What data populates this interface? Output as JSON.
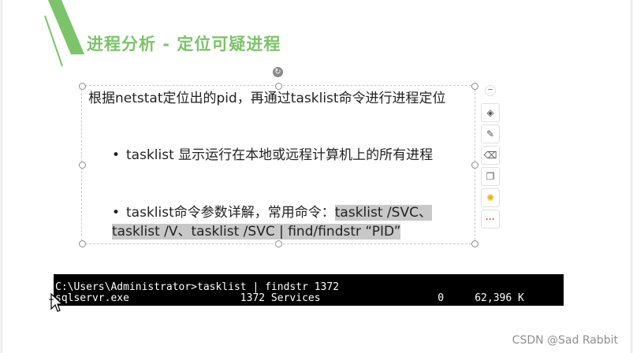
{
  "slide": {
    "title": "进程分析 - 定位可疑进程",
    "paragraph1": "根据netstat定位出的pid，再通过tasklist命令进行进程定位",
    "bullet1": "tasklist 显示运行在本地或远程计算机上的所有进程",
    "bullet2_plain": "tasklist命令参数详解，常用命令：",
    "bullet2_highlight": "tasklist /SVC、tasklist /V、tasklist /SVC | find/findstr “PID”",
    "bullet_char": "•"
  },
  "terminal": {
    "line1": "C:\\Users\\Administrator>tasklist | findstr 1372",
    "line2": "sqlservr.exe                  1372 Services                   0     62,396 K"
  },
  "toolbar": {
    "icons": [
      "collapse-icon",
      "layers-icon",
      "pen-icon",
      "eraser-icon",
      "copy-icon",
      "bulb-icon",
      "more-icon"
    ],
    "glyphs": [
      "−",
      "◈",
      "✎",
      "⌫",
      "❐",
      "✺",
      "···"
    ]
  },
  "rotate_glyph": "↻",
  "watermark": "CSDN @Sad Rabbit",
  "colors": {
    "title": "#7cc36a",
    "accent_stripe": "#7cc36a",
    "highlight": "#c8c8c8",
    "more": "#e04a2a",
    "bulb": "#e8b400"
  }
}
